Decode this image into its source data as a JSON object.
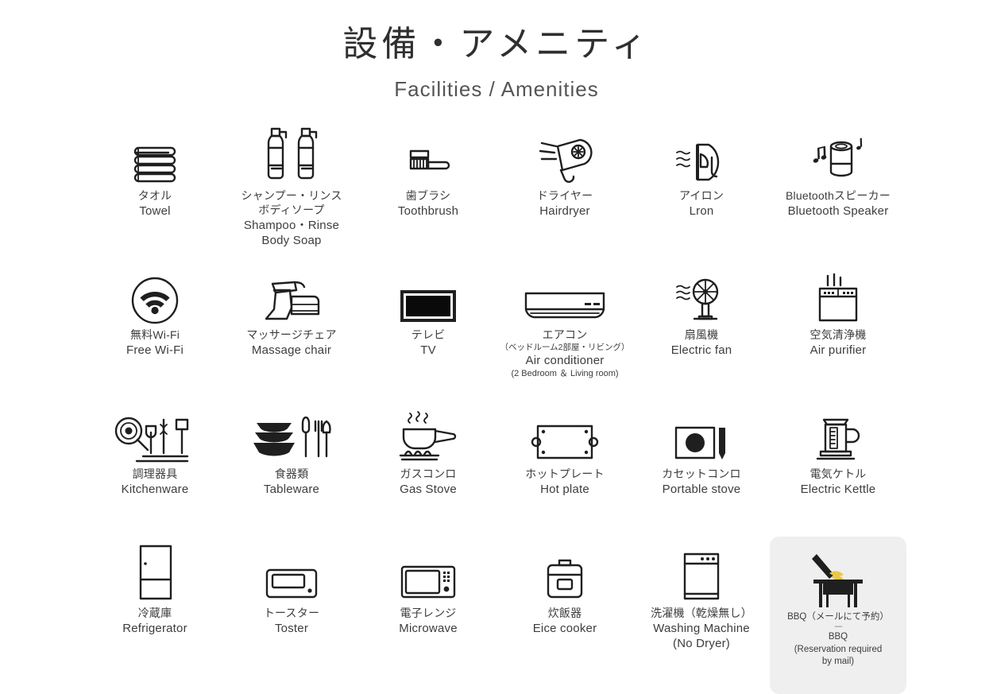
{
  "header": {
    "title_jp": "設備・アメニティ",
    "title_en": "Facilities / Amenities"
  },
  "colors": {
    "icon_stroke": "#1f1f1f",
    "text": "#3d3d3d",
    "highlight_background": "#efefef",
    "bbq_flame": "#e8c84a",
    "page_background": "#ffffff"
  },
  "items": [
    {
      "icon": "towel-icon",
      "jp": "タオル",
      "en": "Towel"
    },
    {
      "icon": "shampoo-bottles-icon",
      "jp": "シャンプー・リンス",
      "jp2": "ボディソープ",
      "en": "Shampoo・Rinse",
      "en2": "Body Soap"
    },
    {
      "icon": "toothbrush-icon",
      "jp": "歯ブラシ",
      "en": "Toothbrush"
    },
    {
      "icon": "hairdryer-icon",
      "jp": "ドライヤー",
      "en": "Hairdryer"
    },
    {
      "icon": "iron-icon",
      "jp": "アイロン",
      "en": "Lron"
    },
    {
      "icon": "bluetooth-speaker-icon",
      "jp": "Bluetoothスピーカー",
      "en": "Bluetooth Speaker"
    },
    {
      "icon": "wifi-icon",
      "jp": "無料Wi-Fi",
      "en": "Free Wi-Fi"
    },
    {
      "icon": "massage-chair-icon",
      "jp": "マッサージチェア",
      "en": "Massage chair"
    },
    {
      "icon": "tv-icon",
      "jp": "テレビ",
      "en": "TV"
    },
    {
      "icon": "air-conditioner-icon",
      "jp": "エアコン",
      "jp_sub": "（ベッドルーム2部屋・リビング）",
      "en": "Air conditioner",
      "en_sub": "(2 Bedroom ＆ Living room)"
    },
    {
      "icon": "electric-fan-icon",
      "jp": "扇風機",
      "en": "Electric fan"
    },
    {
      "icon": "air-purifier-icon",
      "jp": "空気清浄機",
      "en": "Air purifier"
    },
    {
      "icon": "kitchenware-icon",
      "jp": "調理器具",
      "en": "Kitchenware"
    },
    {
      "icon": "tableware-icon",
      "jp": "食器類",
      "en": "Tableware"
    },
    {
      "icon": "gas-stove-icon",
      "jp": "ガスコンロ",
      "en": "Gas Stove"
    },
    {
      "icon": "hot-plate-icon",
      "jp": "ホットプレート",
      "en": "Hot plate"
    },
    {
      "icon": "portable-stove-icon",
      "jp": "カセットコンロ",
      "en": "Portable stove"
    },
    {
      "icon": "electric-kettle-icon",
      "jp": "電気ケトル",
      "en": "Electric Kettle"
    },
    {
      "icon": "refrigerator-icon",
      "jp": "冷蔵庫",
      "en": "Refrigerator"
    },
    {
      "icon": "toaster-icon",
      "jp": "トースター",
      "en": "Toster"
    },
    {
      "icon": "microwave-icon",
      "jp": "電子レンジ",
      "en": "Microwave"
    },
    {
      "icon": "rice-cooker-icon",
      "jp": "炊飯器",
      "en": "Eice cooker"
    },
    {
      "icon": "washing-machine-icon",
      "jp": "洗濯機（乾燥無し）",
      "en": "Washing Machine",
      "en2": "(No Dryer)"
    },
    {
      "icon": "bbq-grill-icon",
      "jp": "BBQ（メールにて予約）",
      "sep": "----",
      "en": "BBQ",
      "en2": "(Reservation required",
      "en3": "by mail)",
      "highlight": true
    }
  ]
}
